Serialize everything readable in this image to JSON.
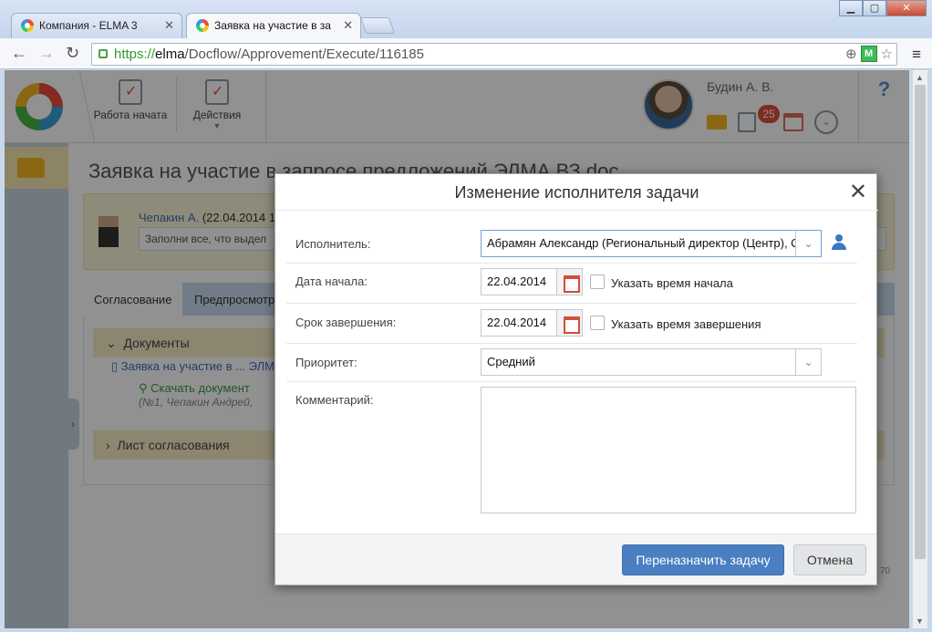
{
  "browser": {
    "tabs": [
      {
        "title": "Компания - ELMA 3",
        "active": false
      },
      {
        "title": "Заявка на участие в за",
        "active": true
      }
    ],
    "url": {
      "scheme": "https://",
      "host": "elma",
      "path": "/Docflow/Approvement/Execute/116185"
    }
  },
  "header": {
    "actions": [
      {
        "label": "Работа начата"
      },
      {
        "label": "Действия"
      }
    ],
    "user_name": "Будин А. В.",
    "tasks_badge": "25",
    "help": "?"
  },
  "document": {
    "title": "Заявка на участие в запросе предложений ЭЛМА ВЗ.doc",
    "note": {
      "author": "Чепакин А.",
      "date": "(22.04.2014 1",
      "text": "Заполни все, что выдел"
    },
    "tabs": [
      {
        "label": "Согласование"
      },
      {
        "label": "Предпросмотр"
      }
    ],
    "sections": {
      "documents": "Документы",
      "approval_sheet": "Лист согласования"
    },
    "doc_link": "Заявка на участие в ... ЭЛМ",
    "download_label": "Скачать документ",
    "download_meta": "(№1, Чепакин Андрей,",
    "page_num": "70"
  },
  "modal": {
    "title": "Изменение исполнителя задачи",
    "fields": {
      "executor": {
        "label": "Исполнитель:",
        "value": "Абрамян Александр (Региональный директор (Центр), Со"
      },
      "start_date": {
        "label": "Дата начала:",
        "value": "22.04.2014",
        "checkbox_label": "Указать время начала"
      },
      "due_date": {
        "label": "Срок завершения:",
        "value": "22.04.2014",
        "checkbox_label": "Указать время завершения"
      },
      "priority": {
        "label": "Приоритет:",
        "value": "Средний"
      },
      "comment": {
        "label": "Комментарий:",
        "value": ""
      }
    },
    "buttons": {
      "reassign": "Переназначить задачу",
      "cancel": "Отмена"
    }
  },
  "colors": {
    "accent": "#4a7fc1",
    "badge": "#e04c3a",
    "link": "#3f6fb5",
    "download": "#3f9a3f"
  }
}
